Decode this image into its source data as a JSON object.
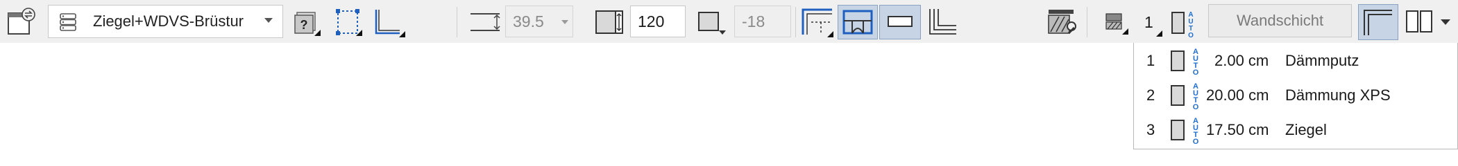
{
  "toolbar": {
    "composite_name": "Ziegel+WDVS-Brüstur",
    "height_value": "39.5",
    "thickness_value": "120",
    "offset_value": "-18",
    "layer_number": "1",
    "layer_name_button": "Wandschicht",
    "auto_label": "AUTO"
  },
  "layers": [
    {
      "index": "1",
      "thickness": "2.00 cm",
      "name": "Dämmputz"
    },
    {
      "index": "2",
      "thickness": "20.00 cm",
      "name": "Dämmung XPS"
    },
    {
      "index": "3",
      "thickness": "17.50 cm",
      "name": "Ziegel"
    }
  ],
  "colors": {
    "toolbar_bg": "#f0f0f0",
    "pressed_bg": "#c6d4e6",
    "accent_blue": "#1f5fbf",
    "auto_blue": "#1f6fd1"
  },
  "icons": [
    "window-settings-icon",
    "composite-stack-icon",
    "help-missing-icon",
    "selection-frame-icon",
    "corner-tool-icon",
    "height-icon",
    "thickness-icon",
    "offset-icon",
    "border-dashed-icon",
    "arch-frame-icon",
    "rect-frame-icon",
    "corner-lines-icon",
    "hatch-settings-icon",
    "hatch-icon",
    "layer-icon",
    "double-frame-icon",
    "split-panel-icon"
  ]
}
